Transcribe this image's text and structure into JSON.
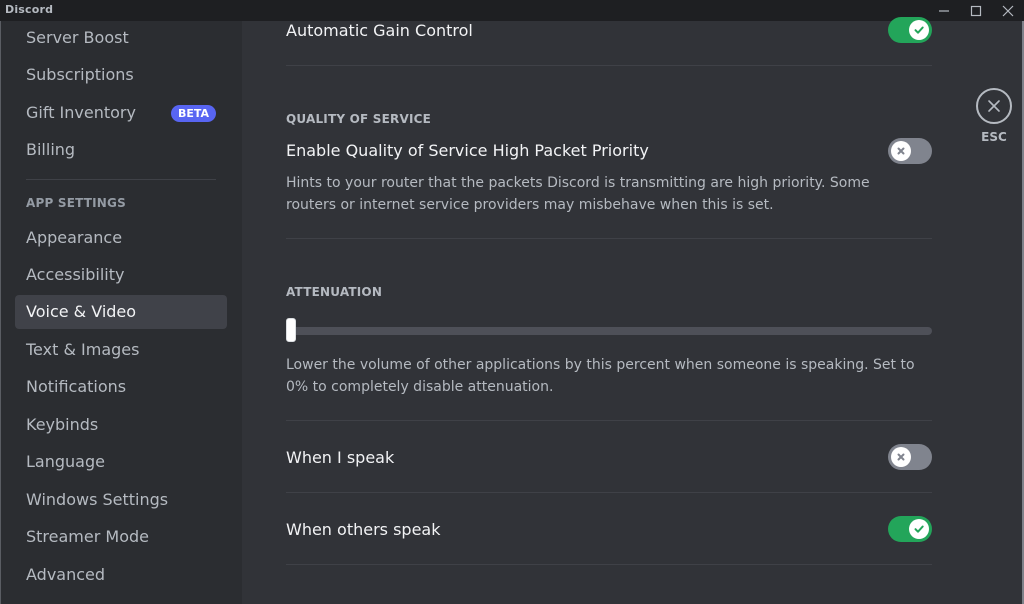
{
  "window": {
    "title": "Discord",
    "controls": {
      "minimize_icon": "minimize-icon",
      "maximize_icon": "maximize-icon",
      "close_icon": "close-icon"
    }
  },
  "sidebar": {
    "items_top": [
      {
        "label": "Server Boost"
      },
      {
        "label": "Subscriptions"
      },
      {
        "label": "Gift Inventory",
        "badge": "BETA"
      },
      {
        "label": "Billing"
      }
    ],
    "app_settings_header": "APP SETTINGS",
    "items_app": [
      {
        "label": "Appearance"
      },
      {
        "label": "Accessibility"
      },
      {
        "label": "Voice & Video",
        "active": true
      },
      {
        "label": "Text & Images"
      },
      {
        "label": "Notifications"
      },
      {
        "label": "Keybinds"
      },
      {
        "label": "Language"
      },
      {
        "label": "Windows Settings"
      },
      {
        "label": "Streamer Mode"
      },
      {
        "label": "Advanced"
      }
    ]
  },
  "content": {
    "agc": {
      "title": "Automatic Gain Control",
      "enabled": true
    },
    "qos": {
      "header": "QUALITY OF SERVICE",
      "title": "Enable Quality of Service High Packet Priority",
      "description": "Hints to your router that the packets Discord is transmitting are high priority. Some routers or internet service providers may misbehave when this is set.",
      "enabled": false
    },
    "attenuation": {
      "header": "ATTENUATION",
      "value_percent": 0,
      "description": "Lower the volume of other applications by this percent when someone is speaking. Set to 0% to completely disable attenuation."
    },
    "when_i_speak": {
      "title": "When I speak",
      "enabled": false
    },
    "when_others_speak": {
      "title": "When others speak",
      "enabled": true
    }
  },
  "esc": {
    "label": "ESC",
    "icon": "close-circle-icon"
  },
  "colors": {
    "accent": "#5865f2",
    "toggle_on": "#23a55a",
    "toggle_off": "#80848e",
    "background": "#313338",
    "sidebar": "#2b2d31"
  }
}
